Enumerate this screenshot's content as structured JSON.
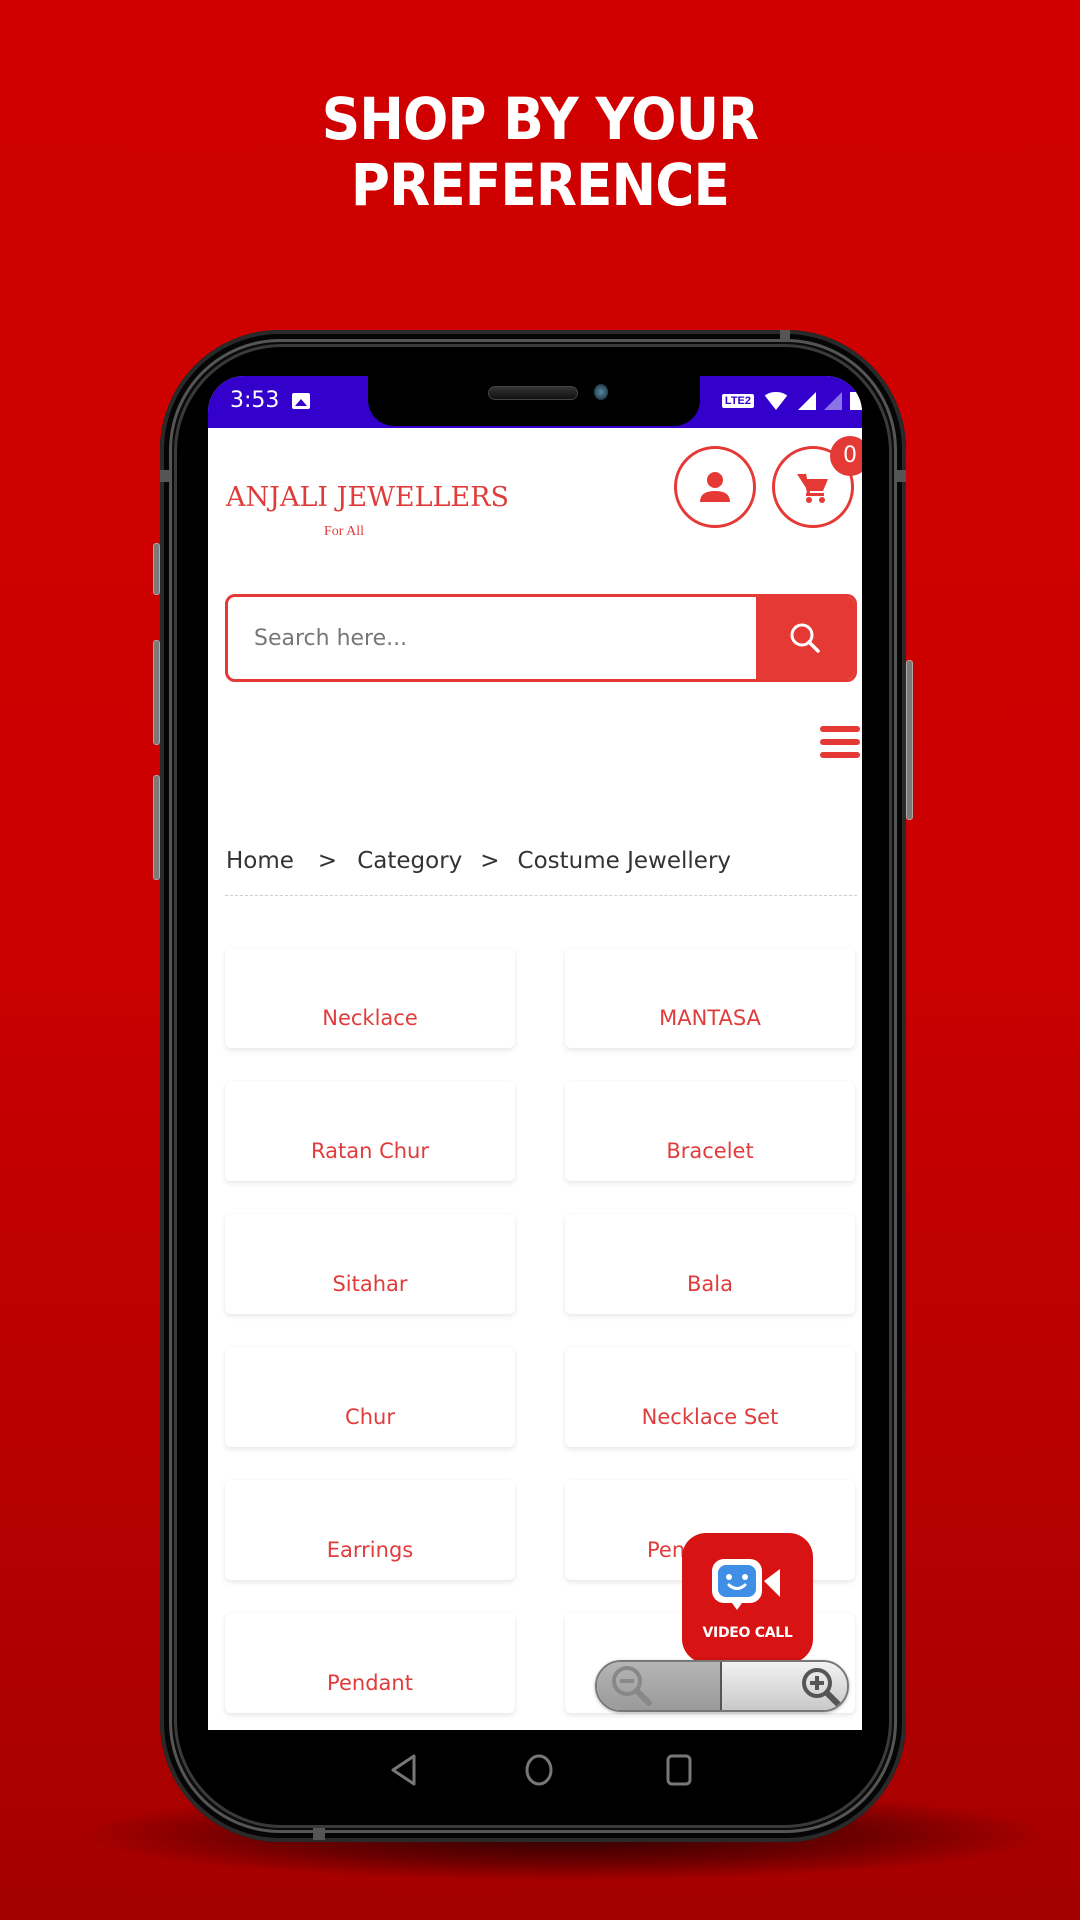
{
  "promo": {
    "headline_line1": "SHOP BY YOUR",
    "headline_line2": "PREFERENCE"
  },
  "status_bar": {
    "time": "3:53",
    "network": "LTE2",
    "icons": [
      "image-icon",
      "lte-icon",
      "wifi-icon",
      "signal-icon",
      "signal-icon",
      "battery-icon"
    ]
  },
  "header": {
    "brand_name": "ANJALI JEWELLERS",
    "brand_tagline": "For All",
    "cart_count": "0"
  },
  "search": {
    "placeholder": "Search here..."
  },
  "breadcrumb": {
    "items": [
      "Home",
      "Category",
      "Costume Jewellery"
    ],
    "separator": ">"
  },
  "categories": [
    {
      "label": "Necklace"
    },
    {
      "label": "MANTASA"
    },
    {
      "label": "Ratan Chur"
    },
    {
      "label": "Bracelet"
    },
    {
      "label": "Sitahar"
    },
    {
      "label": "Bala"
    },
    {
      "label": "Chur"
    },
    {
      "label": "Necklace Set"
    },
    {
      "label": "Earrings"
    },
    {
      "label": "Pen"
    },
    {
      "label": "Pendant"
    },
    {
      "label": ""
    }
  ],
  "video_call": {
    "label": "VIDEO CALL"
  },
  "colors": {
    "brand_red": "#e53935",
    "status_bar": "#3300cc",
    "background_red": "#cc0000",
    "video_call_red": "#d71313"
  }
}
